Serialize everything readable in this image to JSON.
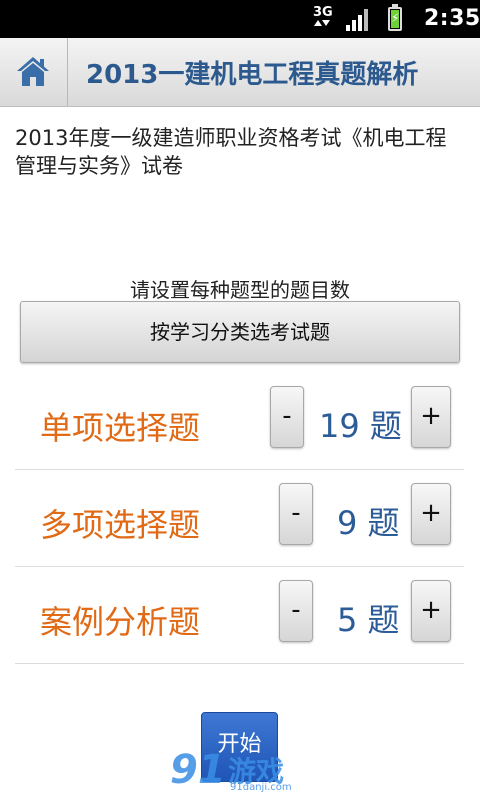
{
  "status_bar": {
    "network": "3G",
    "time": "2:35"
  },
  "header": {
    "title": "2013一建机电工程真题解析",
    "home_icon": "home-icon"
  },
  "description": "2013年度一级建造师职业资格考试《机电工程管理与实务》试卷",
  "hint": "请设置每种题型的题目数",
  "select_by_category_label": "按学习分类选考试题",
  "question_types": [
    {
      "label": "单项选择题",
      "count": "19 题",
      "minus": "-",
      "plus": "+"
    },
    {
      "label": "多项选择题",
      "count": "9 题",
      "minus": "-",
      "plus": "+"
    },
    {
      "label": "案例分析题",
      "count": "5 题",
      "minus": "-",
      "plus": "+"
    }
  ],
  "start_label": "开始",
  "watermark": {
    "logo_number": "91",
    "logo_text": "游戏",
    "url": "91danji.com"
  },
  "colors": {
    "title": "#2d5a8e",
    "type_label": "#e06a15",
    "count": "#2b5c97",
    "start_button": "#2a63c6"
  }
}
